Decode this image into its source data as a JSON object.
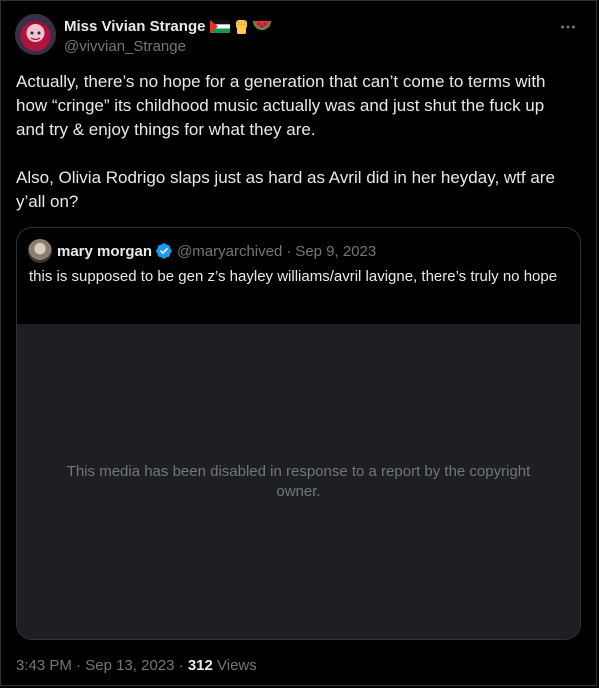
{
  "author": {
    "display_name": "Miss Vivian Strange",
    "handle": "@vivvian_Strange",
    "name_emojis": [
      "palestine-flag",
      "raised-fist",
      "watermelon"
    ]
  },
  "tweet": {
    "paragraphs": [
      "Actually, there’s no hope for a generation that can’t come to terms with how “cringe” its childhood music actually was and just shut the fuck up and try & enjoy things for what they are.",
      "Also, Olivia Rodrigo slaps just as hard as Avril did in her heyday, wtf are y’all on?"
    ]
  },
  "quote": {
    "name": "mary morgan",
    "handle": "@maryarchived",
    "separator": "·",
    "date": "Sep 9, 2023",
    "text": "this is supposed to be gen z’s hayley williams/avril lavigne, there’s truly no hope",
    "media_notice": "This media has been disabled in response to a report by the copyright owner."
  },
  "meta": {
    "time": "3:43 PM",
    "separator": "·",
    "date": "Sep 13, 2023",
    "views_count": "312",
    "views_label": "Views"
  },
  "colors": {
    "background": "#000000",
    "text": "#e7e9ea",
    "secondary": "#71767b",
    "border": "#2f3336",
    "verified": "#1d9bf0",
    "media_box": "#1e1f23"
  }
}
